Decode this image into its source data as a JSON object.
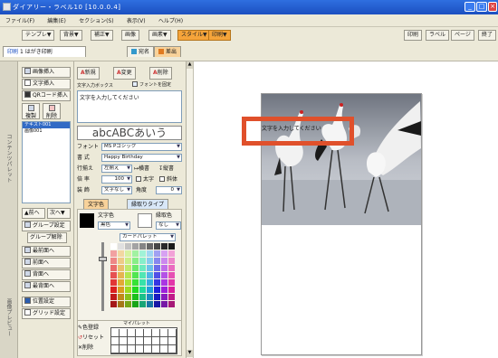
{
  "window": {
    "title": "ダイアリー・ラベル10 [10.0.0.4]",
    "buttons": [
      "_",
      "□",
      "×"
    ]
  },
  "menu": [
    "ファイル(F)",
    "編集(E)",
    "セクション(S)",
    "表示(V)",
    "ヘルプ(H)"
  ],
  "toolbar": {
    "row1": [
      "テンプレ▼",
      "背景▼",
      "補正▼",
      "画像",
      "画素▼",
      "スタイル▼",
      "印刷▼"
    ],
    "row1_right": [
      "印刷",
      "ラベル",
      "ページ",
      "終了"
    ],
    "tabs": [
      "はがき印刷",
      "宛名",
      "差出"
    ],
    "first_tab_index": "1",
    "tab_title_prefix": "印刷"
  },
  "leftstrip": {
    "top_label": "コンテンツパレット",
    "bottom_label": "画像プレビュー"
  },
  "panel1": {
    "image_insert": "画像挿入",
    "text_insert": "文字挿入",
    "qr_insert": "QRコード挿入",
    "copy_label": "複製",
    "delete_label": "削除",
    "list": [
      "テキスト001",
      "画像001"
    ],
    "order_up": "▲前へ",
    "order_down": "次へ▼",
    "group": "グループ設定",
    "group_off": "グループ解除",
    "front_all": "最前面へ",
    "front": "前面へ",
    "back": "背面へ",
    "back_all": "最背面へ",
    "align": "位置設定",
    "grid": "グリッド設定"
  },
  "panel2": {
    "mode_new": "新規",
    "mode_change": "変更",
    "mode_delete": "削除",
    "textbox_label": "文字入力ボックス",
    "font_check": "フォントを固定",
    "textbox_value": "文字を入力してください",
    "preview": "abcABCあいう",
    "font_label": "フォント",
    "font_value": "MS Pゴシック",
    "style_label": "書 式",
    "style_value": "Happy Birthday",
    "size_label": "行揃え",
    "size_value": "左揃え",
    "horiz": "横書",
    "vert": "縦書",
    "rate_label": "倍 率",
    "rate_value": "100",
    "bold": "太字",
    "italic": "斜体",
    "deco_label": "装 飾",
    "deco_value": "文字なし",
    "angle_label": "角度",
    "angle_value": "0",
    "tab_color": "文字色",
    "tab_border": "縁取りタイプ",
    "text_color_label": "文字色",
    "border_color_label": "縁取色",
    "text_color_value": "黒色",
    "border_color_value": "なし",
    "palette_label": "カードパレット",
    "mypalette_label": "マイパレット",
    "color_register": "色登録",
    "reset": "リセット",
    "delete": "削除"
  },
  "canvas": {
    "text_placeholder": "文字を入力してください"
  },
  "colors": {
    "title_bar": "#2f6fe0",
    "highlight": "#e0502b",
    "toolbar_accent": "#f5a43a"
  }
}
